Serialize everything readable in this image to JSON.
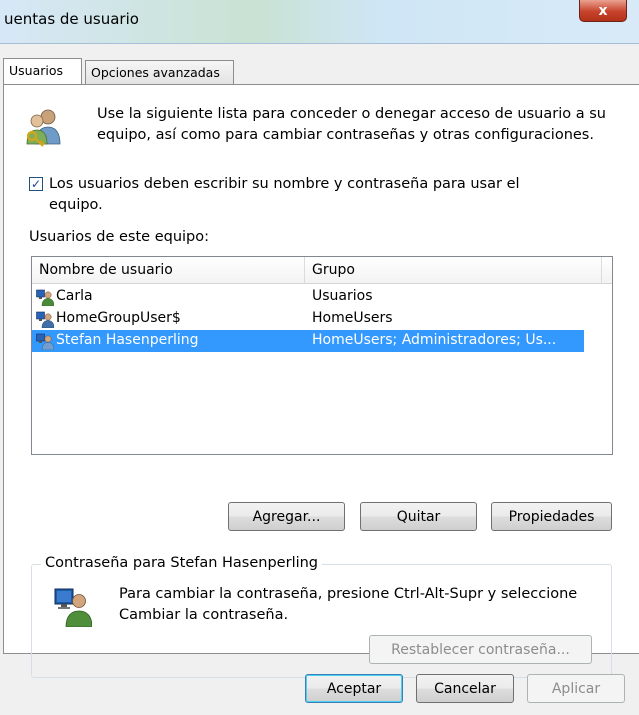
{
  "window": {
    "title": "uentas de usuario",
    "close_label": "x"
  },
  "tabs": [
    {
      "label": "Usuarios",
      "active": true
    },
    {
      "label": "Opciones avanzadas",
      "active": false
    }
  ],
  "intro": {
    "text": "Use la siguiente lista para conceder o denegar acceso de usuario a su equipo, así como para cambiar contraseñas y otras configuraciones.",
    "icon": "users-key-icon"
  },
  "require_login": {
    "checked": true,
    "check_mark": "✓",
    "label": "Los usuarios deben escribir su nombre y contraseña para usar el equipo."
  },
  "users_section": {
    "label": "Usuarios de este equipo:",
    "columns": [
      "Nombre de usuario",
      "Grupo"
    ],
    "rows": [
      {
        "name": "Carla",
        "group": "Usuarios",
        "selected": false
      },
      {
        "name": "HomeGroupUser$",
        "group": "HomeUsers",
        "selected": false
      },
      {
        "name": "Stefan Hasenperling",
        "group": "HomeUsers; Administradores; Us...",
        "selected": true
      }
    ]
  },
  "list_buttons": {
    "add": "Agregar...",
    "remove": "Quitar",
    "properties": "Propiedades"
  },
  "password_group": {
    "legend": "Contraseña para Stefan Hasenperling",
    "text": "Para cambiar la contraseña, presione Ctrl-Alt-Supr y seleccione Cambiar la contraseña.",
    "reset_button": "Restablecer contraseña...",
    "reset_enabled": false
  },
  "dialog_buttons": {
    "ok": "Aceptar",
    "cancel": "Cancelar",
    "apply": "Aplicar",
    "apply_enabled": false
  },
  "colors": {
    "selection": "#3399ff",
    "title_gradient": "#d6e8f7",
    "close_button": "#c7432b"
  }
}
